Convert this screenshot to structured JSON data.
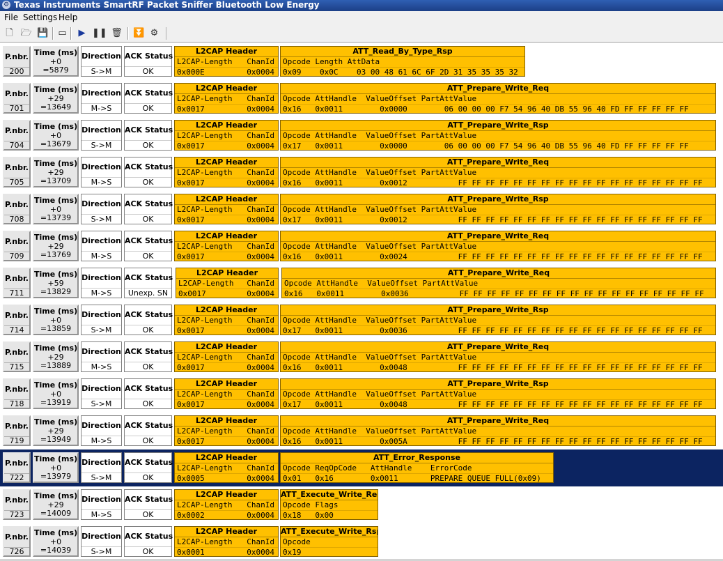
{
  "window": {
    "title": "Texas Instruments SmartRF Packet Sniffer Bluetooth Low Energy"
  },
  "menu": [
    {
      "label": "File"
    },
    {
      "label": "Settings"
    },
    {
      "label": "Help"
    }
  ],
  "toolbar": [
    {
      "name": "new-file-icon",
      "glyph": "🗋"
    },
    {
      "name": "open-folder-icon",
      "glyph": "🗁"
    },
    {
      "name": "save-icon",
      "glyph": "💾"
    },
    {
      "name": "open-capture-icon",
      "glyph": "▭"
    },
    {
      "name": "play-icon",
      "glyph": "▶"
    },
    {
      "name": "pause-icon",
      "glyph": "❚❚"
    },
    {
      "name": "clear-icon",
      "glyph": "🗑"
    },
    {
      "name": "autoscroll-icon",
      "glyph": "⏬"
    },
    {
      "name": "settings-capture-icon",
      "glyph": "⚙"
    }
  ],
  "headers": {
    "pnbr": "P.nbr.",
    "time": "Time (ms)",
    "direction": "Direction",
    "ack": "ACK Status",
    "l2cap": "L2CAP Header",
    "l2cap_fields": "L2CAP-Length",
    "chanid": "ChanId"
  },
  "colors": {
    "packet_field": "#ffc000",
    "selected_row": "#0c2461"
  },
  "packets": [
    {
      "pnbr": "200",
      "delta": "+0",
      "time": "=5879",
      "dir": "S->M",
      "ack": "OK",
      "l2cap_len": "0x000E",
      "chanid": "0x0004",
      "att": {
        "title": "ATT_Read_By_Type_Rsp",
        "hdr": "Opcode Length AttData",
        "val": "0x09    0x0C    03 00 48 61 6C 6F 2D 31 35 35 35 32"
      },
      "selected": false
    },
    {
      "pnbr": "701",
      "delta": "+29",
      "time": "=13649",
      "dir": "M->S",
      "ack": "OK",
      "l2cap_len": "0x0017",
      "chanid": "0x0004",
      "att": {
        "title": "ATT_Prepare_Write_Req",
        "hdr": "Opcode AttHandle  ValueOffset PartAttValue",
        "val": "0x16   0x0011        0x0000        06 00 00 00 F7 54 96 40 DB 55 96 40 FD FF FF FF FF FF"
      },
      "selected": false
    },
    {
      "pnbr": "704",
      "delta": "+0",
      "time": "=13679",
      "dir": "S->M",
      "ack": "OK",
      "l2cap_len": "0x0017",
      "chanid": "0x0004",
      "att": {
        "title": "ATT_Prepare_Write_Rsp",
        "hdr": "Opcode AttHandle  ValueOffset PartAttValue",
        "val": "0x17   0x0011        0x0000        06 00 00 00 F7 54 96 40 DB 55 96 40 FD FF FF FF FF FF"
      },
      "selected": false
    },
    {
      "pnbr": "705",
      "delta": "+29",
      "time": "=13709",
      "dir": "M->S",
      "ack": "OK",
      "l2cap_len": "0x0017",
      "chanid": "0x0004",
      "att": {
        "title": "ATT_Prepare_Write_Req",
        "hdr": "Opcode AttHandle  ValueOffset PartAttValue",
        "val": "0x16   0x0011        0x0012           FF FF FF FF FF FF FF FF FF FF FF FF FF FF FF FF FF FF"
      },
      "selected": false
    },
    {
      "pnbr": "708",
      "delta": "+0",
      "time": "=13739",
      "dir": "S->M",
      "ack": "OK",
      "l2cap_len": "0x0017",
      "chanid": "0x0004",
      "att": {
        "title": "ATT_Prepare_Write_Rsp",
        "hdr": "Opcode AttHandle  ValueOffset PartAttValue",
        "val": "0x17   0x0011        0x0012           FF FF FF FF FF FF FF FF FF FF FF FF FF FF FF FF FF FF"
      },
      "selected": false
    },
    {
      "pnbr": "709",
      "delta": "+29",
      "time": "=13769",
      "dir": "M->S",
      "ack": "OK",
      "l2cap_len": "0x0017",
      "chanid": "0x0004",
      "att": {
        "title": "ATT_Prepare_Write_Req",
        "hdr": "Opcode AttHandle  ValueOffset PartAttValue",
        "val": "0x16   0x0011        0x0024           FF FF FF FF FF FF FF FF FF FF FF FF FF FF FF FF FF FF"
      },
      "selected": false
    },
    {
      "pnbr": "711",
      "delta": "+59",
      "time": "=13829",
      "dir": "M->S",
      "ack": "Unexp. SN",
      "l2cap_len": "0x0017",
      "chanid": "0x0004",
      "att": {
        "title": "ATT_Prepare_Write_Req",
        "hdr": "Opcode AttHandle  ValueOffset PartAttValue",
        "val": "0x16   0x0011        0x0036           FF FF FF FF FF FF FF FF FF FF FF FF FF FF FF FF FF FF"
      },
      "selected": false
    },
    {
      "pnbr": "714",
      "delta": "+0",
      "time": "=13859",
      "dir": "S->M",
      "ack": "OK",
      "l2cap_len": "0x0017",
      "chanid": "0x0004",
      "att": {
        "title": "ATT_Prepare_Write_Rsp",
        "hdr": "Opcode AttHandle  ValueOffset PartAttValue",
        "val": "0x17   0x0011        0x0036           FF FF FF FF FF FF FF FF FF FF FF FF FF FF FF FF FF FF"
      },
      "selected": false
    },
    {
      "pnbr": "715",
      "delta": "+29",
      "time": "=13889",
      "dir": "M->S",
      "ack": "OK",
      "l2cap_len": "0x0017",
      "chanid": "0x0004",
      "att": {
        "title": "ATT_Prepare_Write_Req",
        "hdr": "Opcode AttHandle  ValueOffset PartAttValue",
        "val": "0x16   0x0011        0x0048           FF FF FF FF FF FF FF FF FF FF FF FF FF FF FF FF FF FF"
      },
      "selected": false
    },
    {
      "pnbr": "718",
      "delta": "+0",
      "time": "=13919",
      "dir": "S->M",
      "ack": "OK",
      "l2cap_len": "0x0017",
      "chanid": "0x0004",
      "att": {
        "title": "ATT_Prepare_Write_Rsp",
        "hdr": "Opcode AttHandle  ValueOffset PartAttValue",
        "val": "0x17   0x0011        0x0048           FF FF FF FF FF FF FF FF FF FF FF FF FF FF FF FF FF FF"
      },
      "selected": false
    },
    {
      "pnbr": "719",
      "delta": "+29",
      "time": "=13949",
      "dir": "M->S",
      "ack": "OK",
      "l2cap_len": "0x0017",
      "chanid": "0x0004",
      "att": {
        "title": "ATT_Prepare_Write_Req",
        "hdr": "Opcode AttHandle  ValueOffset PartAttValue",
        "val": "0x16   0x0011        0x005A           FF FF FF FF FF FF FF FF FF FF FF FF FF FF FF FF FF FF"
      },
      "selected": false
    },
    {
      "pnbr": "722",
      "delta": "+0",
      "time": "=13979",
      "dir": "S->M",
      "ack": "OK",
      "l2cap_len": "0x0005",
      "chanid": "0x0004",
      "att": {
        "title": "ATT_Error_Response",
        "hdr": "Opcode ReqOpCode   AttHandle    ErrorCode",
        "val": "0x01   0x16        0x0011       PREPARE_QUEUE_FULL(0x09)"
      },
      "selected": true
    },
    {
      "pnbr": "723",
      "delta": "+29",
      "time": "=14009",
      "dir": "M->S",
      "ack": "OK",
      "l2cap_len": "0x0002",
      "chanid": "0x0004",
      "att": {
        "title": "ATT_Execute_Write_Req",
        "hdr": "Opcode Flags",
        "val": "0x18   0x00"
      },
      "selected": false
    },
    {
      "pnbr": "726",
      "delta": "+0",
      "time": "=14039",
      "dir": "S->M",
      "ack": "OK",
      "l2cap_len": "0x0001",
      "chanid": "0x0004",
      "att": {
        "title": "ATT_Execute_Write_Rsp",
        "hdr": "Opcode",
        "val": "0x19"
      },
      "selected": false
    }
  ]
}
